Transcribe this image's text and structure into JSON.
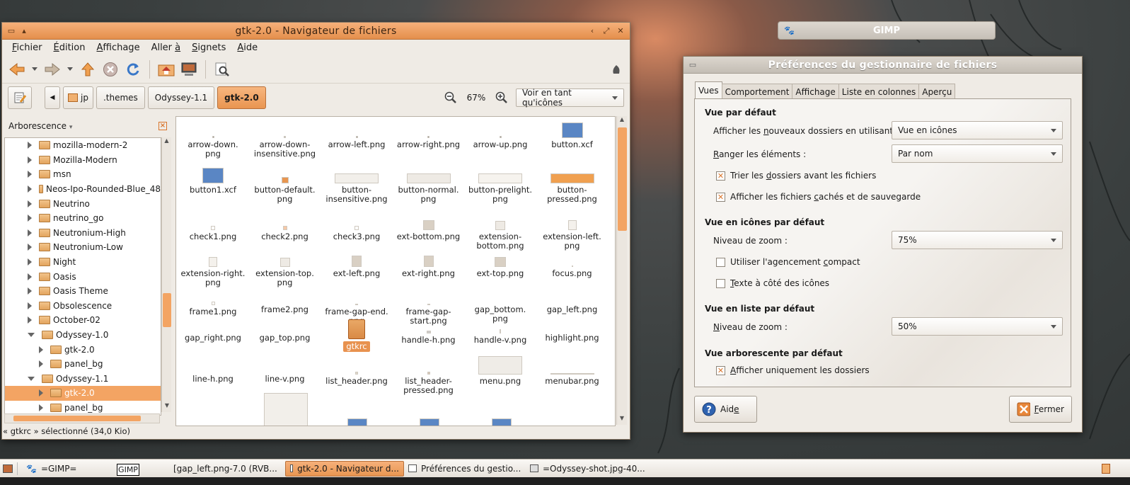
{
  "file_manager": {
    "title": "gtk-2.0 - Navigateur de fichiers",
    "menu": {
      "fichier": {
        "u": "F",
        "rest": "ichier"
      },
      "edition": {
        "u": "É",
        "rest": "dition"
      },
      "affichage": {
        "u": "A",
        "rest": "ffichage"
      },
      "aller": {
        "pre": "Aller ",
        "u": "à",
        "rest": ""
      },
      "signets": {
        "u": "S",
        "rest": "ignets"
      },
      "aide": {
        "u": "A",
        "rest": "ide"
      }
    },
    "path": [
      "jp",
      ".themes",
      "Odyssey-1.1",
      "gtk-2.0"
    ],
    "zoom_level": "67%",
    "view_mode": "Voir en tant qu'icônes",
    "sidebar_title": "Arborescence",
    "tree": [
      {
        "label": "mozilla-modern-2",
        "depth": 0,
        "open": false
      },
      {
        "label": "Mozilla-Modern",
        "depth": 0,
        "open": false
      },
      {
        "label": "msn",
        "depth": 0,
        "open": false
      },
      {
        "label": "Neos-Ipo-Rounded-Blue_48",
        "depth": 0,
        "open": false
      },
      {
        "label": "Neutrino",
        "depth": 0,
        "open": false
      },
      {
        "label": "neutrino_go",
        "depth": 0,
        "open": false
      },
      {
        "label": "Neutronium-High",
        "depth": 0,
        "open": false
      },
      {
        "label": "Neutronium-Low",
        "depth": 0,
        "open": false
      },
      {
        "label": "Night",
        "depth": 0,
        "open": false
      },
      {
        "label": "Oasis",
        "depth": 0,
        "open": false
      },
      {
        "label": "Oasis Theme",
        "depth": 0,
        "open": false
      },
      {
        "label": "Obsolescence",
        "depth": 0,
        "open": false
      },
      {
        "label": "October-02",
        "depth": 0,
        "open": false
      },
      {
        "label": "Odyssey-1.0",
        "depth": 0,
        "open": true
      },
      {
        "label": "gtk-2.0",
        "depth": 1,
        "open": false
      },
      {
        "label": "panel_bg",
        "depth": 1,
        "open": false
      },
      {
        "label": "Odyssey-1.1",
        "depth": 0,
        "open": true
      },
      {
        "label": "gtk-2.0",
        "depth": 1,
        "open": false,
        "selected": true
      },
      {
        "label": "panel_bg",
        "depth": 1,
        "open": false
      }
    ],
    "files": [
      [
        "arrow-down.\npng",
        "arrow-down-\ninsensitive.png",
        "arrow-left.png",
        "arrow-right.png",
        "arrow-up.png",
        "button.xcf"
      ],
      [
        "button1.xcf",
        "button-default.\npng",
        "button-\ninsensitive.png",
        "button-normal.\npng",
        "button-prelight.\npng",
        "button-\npressed.png"
      ],
      [
        "check1.png",
        "check2.png",
        "check3.png",
        "ext-bottom.png",
        "extension-\nbottom.png",
        "extension-left.\npng"
      ],
      [
        "extension-right.\npng",
        "extension-top.\npng",
        "ext-left.png",
        "ext-right.png",
        "ext-top.png",
        "focus.png"
      ],
      [
        "frame1.png",
        "frame2.png",
        "frame-gap-end.\npng",
        "frame-gap-\nstart.png",
        "gap_bottom.\npng",
        "gap_left.png"
      ],
      [
        "gap_right.png",
        "gap_top.png",
        "gtkrc",
        "handle-h.png",
        "handle-v.png",
        "highlight.png"
      ],
      [
        "line-h.png",
        "line-v.png",
        "list_header.png",
        "list_header-\npressed.png",
        "menu.png",
        "menubar.png"
      ]
    ],
    "status": "« gtkrc » sélectionné (34,0 Kio)"
  },
  "gimp_title": "GIMP",
  "prefs": {
    "title": "Préférences du gestionnaire de fichiers",
    "tabs": [
      "Vues",
      "Comportement",
      "Affichage",
      "Liste en colonnes",
      "Aperçu"
    ],
    "sections": {
      "default_view": "Vue par défaut",
      "icon_view": "Vue en icônes par défaut",
      "list_view": "Vue en liste par défaut",
      "tree_view": "Vue arborescente par défaut"
    },
    "labels": {
      "new_folders": {
        "pre": "Afficher les ",
        "u": "n",
        "rest": "ouveaux dossiers en utilisant :"
      },
      "arrange": {
        "pre": "",
        "u": "R",
        "rest": "anger les éléments :"
      },
      "sort_folders": {
        "pre": "Trier les ",
        "u": "d",
        "rest": "ossiers avant les fichiers"
      },
      "show_hidden": {
        "pre": "Afficher les fichiers ",
        "u": "c",
        "rest": "achés et de sauvegarde"
      },
      "icon_zoom": {
        "pre": "Niveau de zoom :",
        "u": "",
        "rest": ""
      },
      "compact": {
        "pre": "Utiliser l'agencement ",
        "u": "c",
        "rest": "ompact"
      },
      "text_beside": {
        "pre": "",
        "u": "T",
        "rest": "exte à côté des icônes"
      },
      "list_zoom": {
        "pre": "",
        "u": "N",
        "rest": "iveau de zoom :"
      },
      "only_folders": {
        "pre": "",
        "u": "A",
        "rest": "fficher uniquement les dossiers"
      }
    },
    "values": {
      "new_folders": "Vue en icônes",
      "arrange": "Par nom",
      "icon_zoom": "75%",
      "list_zoom": "50%"
    },
    "checks": {
      "sort_folders": true,
      "show_hidden": true,
      "compact": false,
      "text_beside": false,
      "only_folders": true
    },
    "help_button": {
      "pre": "Aid",
      "u": "e",
      "rest": ""
    },
    "close_button": {
      "pre": "",
      "u": "F",
      "rest": "ermer"
    }
  },
  "taskbar": {
    "items": [
      "=GIMP=",
      "[gap_left.png-7.0 (RVB...",
      "gtk-2.0 - Navigateur d...",
      "Préférences du gestio...",
      "=Odyssey-shot.jpg-40..."
    ],
    "tooltip": "GIMP"
  },
  "colors": {
    "accent": "#e8924f",
    "selection": "#f3a463"
  }
}
